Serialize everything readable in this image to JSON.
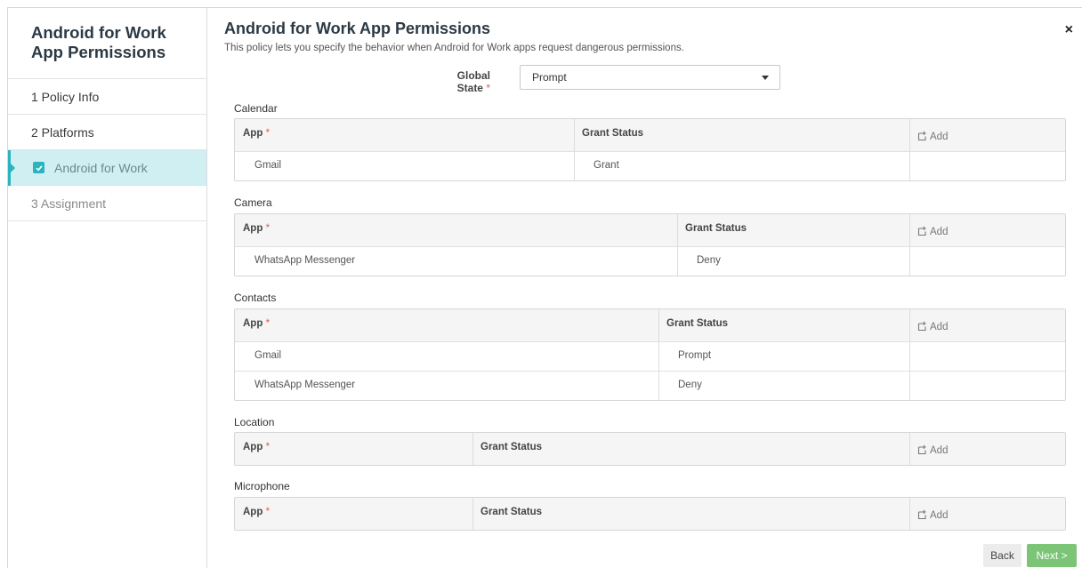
{
  "sidebar": {
    "title_line1": "Android for Work",
    "title_line2": "App Permissions",
    "items": [
      {
        "label": "1 Policy Info"
      },
      {
        "label": "2 Platforms"
      },
      {
        "label": "Android for Work"
      },
      {
        "label": "3 Assignment"
      }
    ]
  },
  "header": {
    "title": "Android for Work App Permissions",
    "description": "This policy lets you specify the behavior when Android for Work apps request dangerous permissions.",
    "close": "×"
  },
  "global_state": {
    "label": "Global State",
    "required_mark": "*",
    "value": "Prompt"
  },
  "table_headers": {
    "app": "App",
    "required_mark": "*",
    "grant_status": "Grant Status",
    "add": "Add"
  },
  "sections": {
    "calendar": {
      "title": "Calendar",
      "rows": [
        {
          "app": "Gmail",
          "status": "Grant"
        }
      ]
    },
    "camera": {
      "title": "Camera",
      "rows": [
        {
          "app": "WhatsApp Messenger",
          "status": "Deny"
        }
      ]
    },
    "contacts": {
      "title": "Contacts",
      "rows": [
        {
          "app": "Gmail",
          "status": "Prompt"
        },
        {
          "app": "WhatsApp Messenger",
          "status": "Deny"
        }
      ]
    },
    "location": {
      "title": "Location",
      "rows": []
    },
    "microphone": {
      "title": "Microphone",
      "rows": []
    }
  },
  "footer": {
    "back_label": "Back",
    "next_label": "Next >"
  },
  "colors": {
    "accent": "#2bb3c0",
    "active_bg": "#cfeff2",
    "next_button": "#7cc576",
    "required": "#e05a5a"
  }
}
